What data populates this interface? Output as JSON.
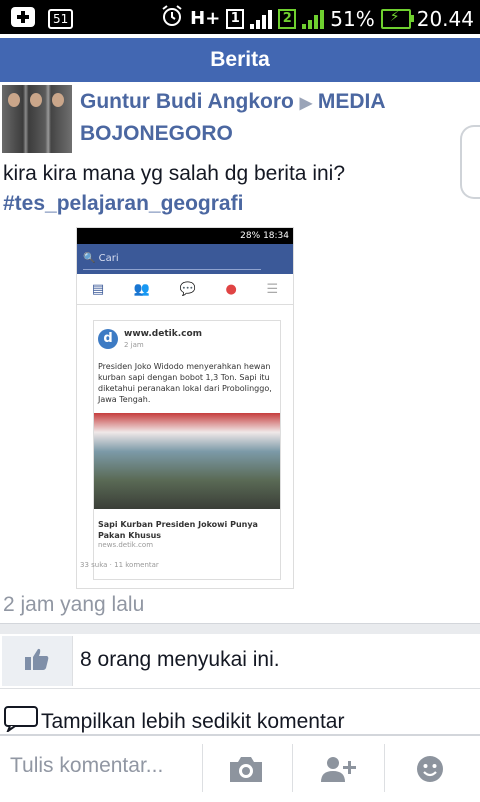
{
  "status_bar": {
    "notif_box": "51",
    "network_type": "H+",
    "sim1": "1",
    "sim2": "2",
    "battery_percent": "51%",
    "time": "20.44"
  },
  "header": {
    "title": "Berita"
  },
  "post": {
    "author": "Guntur Budi Angkoro",
    "target": "MEDIA BOJONEGORO",
    "text": "kira kira mana yg salah dg berita ini?",
    "hashtag": "#tes_pelajaran_geografi",
    "timestamp": "2 jam yang lalu"
  },
  "embedded_screenshot": {
    "status_time": "18:34",
    "status_battery": "28%",
    "search_placeholder": "Cari",
    "card_source": "www.detik.com",
    "card_time": "2 jam",
    "card_body": "Presiden Joko Widodo menyerahkan hewan kurban sapi dengan bobot 1,3 Ton. Sapi itu diketahui peranakan lokal dari Probolinggo, Jawa Tengah.",
    "card_caption": "Sapi Kurban Presiden Jokowi Punya Pakan Khusus",
    "card_domain": "news.detik.com",
    "card_stats": "33 suka · 11 komentar"
  },
  "likes": {
    "text": "8 orang menyukai ini."
  },
  "comments_toggle": {
    "label": "Tampilkan lebih sedikit komentar"
  },
  "composer": {
    "placeholder": "Tulis komentar..."
  },
  "colors": {
    "header_blue": "#4267b2",
    "link_blue": "#4b67a1",
    "muted_gray": "#9197a3",
    "signal_green": "#6fd02f"
  },
  "icons": {
    "like": "thumbs-up-icon",
    "camera": "camera-icon",
    "add_friend": "add-person-icon",
    "emoji": "smiley-icon",
    "comment": "speech-bubble-icon"
  }
}
